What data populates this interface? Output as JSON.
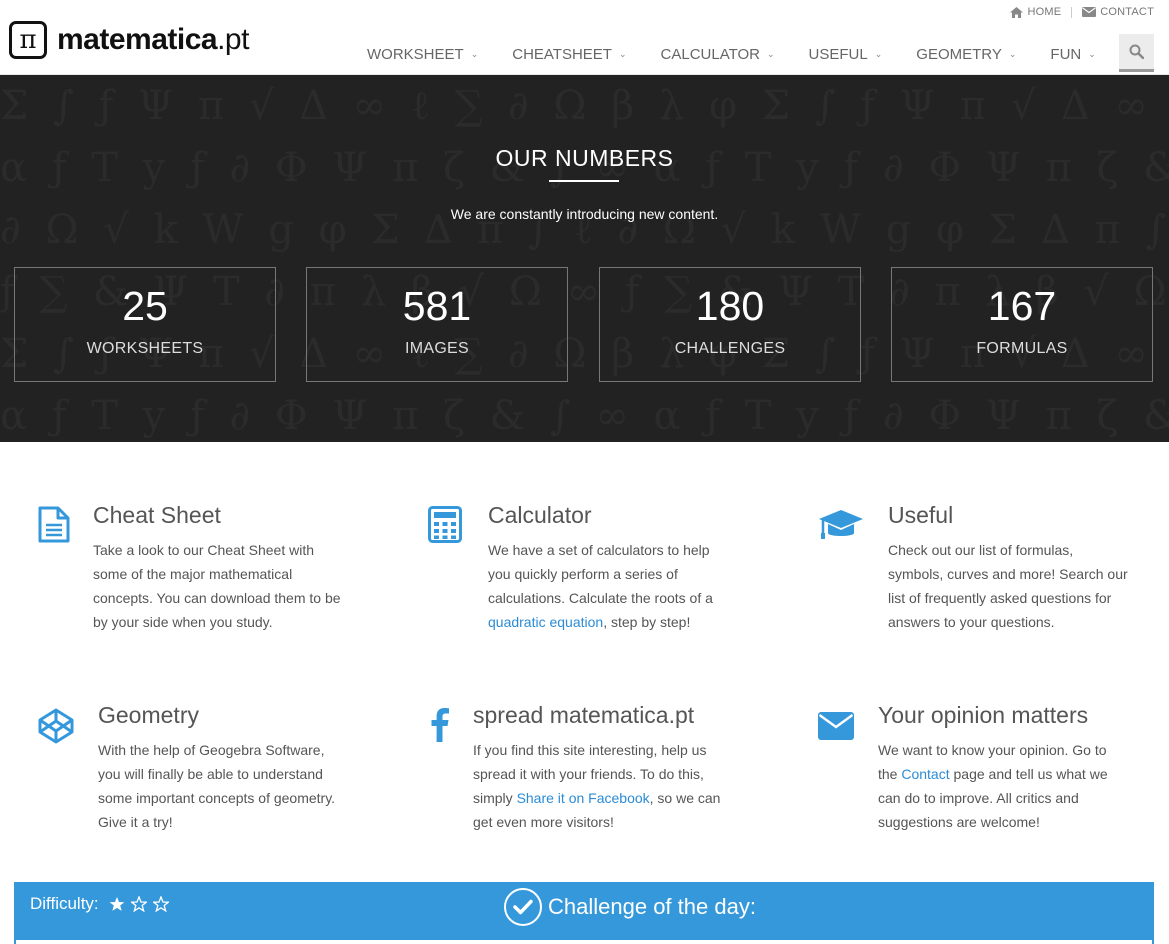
{
  "brand": {
    "logo_symbol": "π",
    "name_main": "matematica",
    "name_tld": ".pt"
  },
  "topbar": {
    "home": "HOME",
    "contact": "CONTACT"
  },
  "nav": {
    "items": [
      {
        "label": "WORKSHEET"
      },
      {
        "label": "CHEATSHEET"
      },
      {
        "label": "CALCULATOR"
      },
      {
        "label": "USEFUL"
      },
      {
        "label": "GEOMETRY"
      },
      {
        "label": "FUN"
      }
    ],
    "search_icon": "search-icon"
  },
  "numbers": {
    "title": "OUR NUMBERS",
    "subtitle": "We are constantly introducing new content.",
    "stats": [
      {
        "value": "25",
        "label": "WORKSHEETS"
      },
      {
        "value": "581",
        "label": "IMAGES"
      },
      {
        "value": "180",
        "label": "CHALLENGES"
      },
      {
        "value": "167",
        "label": "FORMULAS"
      }
    ]
  },
  "features": {
    "cheatsheet": {
      "title": "Cheat Sheet",
      "text": "Take a look to our Cheat Sheet with some of the major mathematical concepts. You can download them to be by your side when you study.",
      "icon": "document-icon"
    },
    "calculator": {
      "title": "Calculator",
      "text_before": "We have a set of calculators to help you quickly perform a series of calculations. Calculate the roots of a ",
      "link": "quadratic equation",
      "text_after": ", step by step!",
      "icon": "calculator-icon"
    },
    "useful": {
      "title": "Useful",
      "text": "Check out our list of formulas, symbols, curves and more! Search our list of frequently asked questions for answers to your questions.",
      "icon": "graduation-cap-icon"
    },
    "geometry": {
      "title": "Geometry",
      "text": "With the help of Geogebra Software, you will finally be able to understand some important concepts of geometry. Give it a try!",
      "icon": "codepen-cube-icon"
    },
    "spread": {
      "title": "spread matematica.pt",
      "text_before": "If you find this site interesting, help us spread it with your friends. To do this, simply ",
      "link": "Share it on Facebook",
      "text_after": ", so we can get even more visitors!",
      "icon": "facebook-icon"
    },
    "opinion": {
      "title": "Your opinion matters",
      "text_before": "We want to know your opinion. Go to the ",
      "link": "Contact",
      "text_after": " page and tell us what we can do to improve. All critics and suggestions are welcome!",
      "icon": "envelope-icon"
    }
  },
  "challenge": {
    "difficulty_label": "Difficulty:",
    "difficulty_level": 1,
    "difficulty_max": 3,
    "title": "Challenge of the day:"
  },
  "colors": {
    "accent": "#3498db",
    "link": "#2b8cd6",
    "dark_band": "#222222"
  }
}
